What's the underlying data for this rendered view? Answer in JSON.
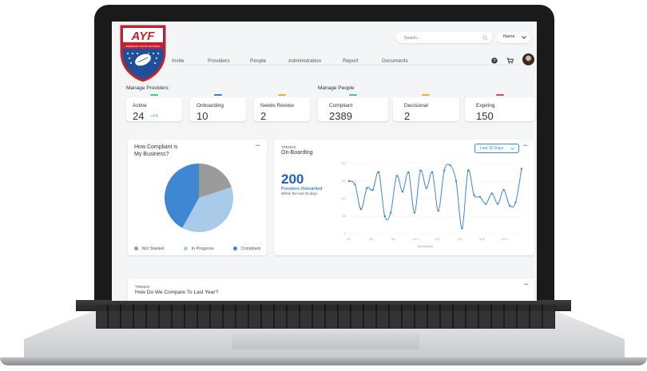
{
  "header": {
    "logo_text": "AYF",
    "logo_subtext": "AMERICAN YOUTH FOOTBALL",
    "search_placeholder": "Search...",
    "user_name": "Name",
    "nav": [
      "Invite",
      "Providers",
      "People",
      "Administration",
      "Report",
      "Documents"
    ]
  },
  "providers": {
    "section_title": "Manage Providers",
    "stats": [
      {
        "label": "Active",
        "value": "24",
        "delta": "+4%",
        "color": "#4cc38a"
      },
      {
        "label": "Onboarding",
        "value": "10",
        "color": "#3b7dd8"
      },
      {
        "label": "Needs Review",
        "value": "2",
        "color": "#f0a93b"
      }
    ]
  },
  "people": {
    "section_title": "Manage People",
    "stats": [
      {
        "label": "Compliant",
        "value": "2389",
        "color": "#4cc38a"
      },
      {
        "label": "Decisional",
        "value": "2",
        "color": "#f0a93b"
      },
      {
        "label": "Expiring",
        "value": "150",
        "color": "#e64545"
      }
    ]
  },
  "compliance": {
    "title_line1": "How Compliant is",
    "title_line2": "My Business?",
    "more": "•••",
    "legend": [
      {
        "label": "Not Started",
        "color": "#9b9b9b"
      },
      {
        "label": "In Progress",
        "color": "#a9cbe9"
      },
      {
        "label": "Compliant",
        "color": "#3f86d3"
      }
    ]
  },
  "onboarding": {
    "kicker": "TRENDS",
    "title": "On-Boarding",
    "range_button": "Last 30 Days",
    "more": "•••",
    "big_number": "200",
    "big_label": "Providers Onboarded",
    "sub_label": "Within the last 30 days",
    "xlabel": "Month/Day"
  },
  "compare": {
    "kicker": "TRENDS",
    "title": "How Do We Compare To Last Year?",
    "more": "•••"
  },
  "chart_data": [
    {
      "type": "pie",
      "title": "How Compliant is My Business?",
      "categories": [
        "Not Started",
        "In Progress",
        "Compliant"
      ],
      "values": [
        20,
        38,
        42
      ],
      "colors": [
        "#9b9b9b",
        "#a9cbe9",
        "#3f86d3"
      ]
    },
    {
      "type": "line",
      "title": "On-Boarding",
      "xlabel": "Month/Day",
      "ylabel": "",
      "ylim": [
        0,
        200
      ],
      "x_ticks": [
        "8/1",
        "8/5",
        "8/9",
        "8/13",
        "8/17",
        "8/21",
        "8/25",
        "8/29"
      ],
      "y_ticks": [
        "0",
        "50",
        "100",
        "150",
        "200"
      ],
      "color": "#3f86d3",
      "values": [
        150,
        140,
        70,
        130,
        125,
        175,
        50,
        60,
        165,
        120,
        175,
        60,
        180,
        130,
        175,
        65,
        180,
        195,
        150,
        15,
        180,
        110,
        105,
        85,
        115,
        85,
        125,
        80,
        90,
        185
      ]
    }
  ]
}
